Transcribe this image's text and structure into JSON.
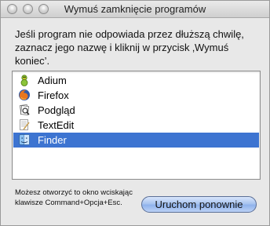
{
  "window": {
    "title": "Wymuś zamknięcie programów"
  },
  "instruction": "Jeśli program nie odpowiada przez dłuższą chwilę, zaznacz jego nazwę i kliknij w przycisk ‚Wymuś koniec’.",
  "apps": [
    {
      "name": "Adium",
      "icon": "adium-duck-icon",
      "selected": false
    },
    {
      "name": "Firefox",
      "icon": "firefox-icon",
      "selected": false
    },
    {
      "name": "Podgląd",
      "icon": "preview-icon",
      "selected": false
    },
    {
      "name": "TextEdit",
      "icon": "textedit-icon",
      "selected": false
    },
    {
      "name": "Finder",
      "icon": "finder-icon",
      "selected": true
    }
  ],
  "hint": "Możesz otworzyć to okno wciskając klawisze Command+Opcja+Esc.",
  "button": {
    "label": "Uruchom ponownie"
  },
  "colors": {
    "selection": "#3d74d1",
    "button": "#a9c4f0"
  }
}
